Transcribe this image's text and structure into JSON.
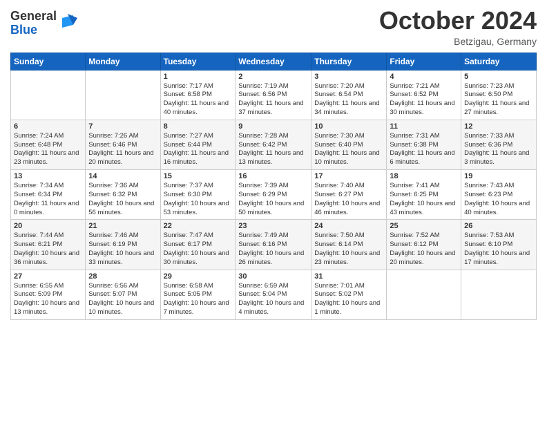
{
  "header": {
    "logo_general": "General",
    "logo_blue": "Blue",
    "month_title": "October 2024",
    "location": "Betzigau, Germany"
  },
  "days_of_week": [
    "Sunday",
    "Monday",
    "Tuesday",
    "Wednesday",
    "Thursday",
    "Friday",
    "Saturday"
  ],
  "weeks": [
    [
      {
        "day": "",
        "sunrise": "",
        "sunset": "",
        "daylight": ""
      },
      {
        "day": "",
        "sunrise": "",
        "sunset": "",
        "daylight": ""
      },
      {
        "day": "1",
        "sunrise": "Sunrise: 7:17 AM",
        "sunset": "Sunset: 6:58 PM",
        "daylight": "Daylight: 11 hours and 40 minutes."
      },
      {
        "day": "2",
        "sunrise": "Sunrise: 7:19 AM",
        "sunset": "Sunset: 6:56 PM",
        "daylight": "Daylight: 11 hours and 37 minutes."
      },
      {
        "day": "3",
        "sunrise": "Sunrise: 7:20 AM",
        "sunset": "Sunset: 6:54 PM",
        "daylight": "Daylight: 11 hours and 34 minutes."
      },
      {
        "day": "4",
        "sunrise": "Sunrise: 7:21 AM",
        "sunset": "Sunset: 6:52 PM",
        "daylight": "Daylight: 11 hours and 30 minutes."
      },
      {
        "day": "5",
        "sunrise": "Sunrise: 7:23 AM",
        "sunset": "Sunset: 6:50 PM",
        "daylight": "Daylight: 11 hours and 27 minutes."
      }
    ],
    [
      {
        "day": "6",
        "sunrise": "Sunrise: 7:24 AM",
        "sunset": "Sunset: 6:48 PM",
        "daylight": "Daylight: 11 hours and 23 minutes."
      },
      {
        "day": "7",
        "sunrise": "Sunrise: 7:26 AM",
        "sunset": "Sunset: 6:46 PM",
        "daylight": "Daylight: 11 hours and 20 minutes."
      },
      {
        "day": "8",
        "sunrise": "Sunrise: 7:27 AM",
        "sunset": "Sunset: 6:44 PM",
        "daylight": "Daylight: 11 hours and 16 minutes."
      },
      {
        "day": "9",
        "sunrise": "Sunrise: 7:28 AM",
        "sunset": "Sunset: 6:42 PM",
        "daylight": "Daylight: 11 hours and 13 minutes."
      },
      {
        "day": "10",
        "sunrise": "Sunrise: 7:30 AM",
        "sunset": "Sunset: 6:40 PM",
        "daylight": "Daylight: 11 hours and 10 minutes."
      },
      {
        "day": "11",
        "sunrise": "Sunrise: 7:31 AM",
        "sunset": "Sunset: 6:38 PM",
        "daylight": "Daylight: 11 hours and 6 minutes."
      },
      {
        "day": "12",
        "sunrise": "Sunrise: 7:33 AM",
        "sunset": "Sunset: 6:36 PM",
        "daylight": "Daylight: 11 hours and 3 minutes."
      }
    ],
    [
      {
        "day": "13",
        "sunrise": "Sunrise: 7:34 AM",
        "sunset": "Sunset: 6:34 PM",
        "daylight": "Daylight: 11 hours and 0 minutes."
      },
      {
        "day": "14",
        "sunrise": "Sunrise: 7:36 AM",
        "sunset": "Sunset: 6:32 PM",
        "daylight": "Daylight: 10 hours and 56 minutes."
      },
      {
        "day": "15",
        "sunrise": "Sunrise: 7:37 AM",
        "sunset": "Sunset: 6:30 PM",
        "daylight": "Daylight: 10 hours and 53 minutes."
      },
      {
        "day": "16",
        "sunrise": "Sunrise: 7:39 AM",
        "sunset": "Sunset: 6:29 PM",
        "daylight": "Daylight: 10 hours and 50 minutes."
      },
      {
        "day": "17",
        "sunrise": "Sunrise: 7:40 AM",
        "sunset": "Sunset: 6:27 PM",
        "daylight": "Daylight: 10 hours and 46 minutes."
      },
      {
        "day": "18",
        "sunrise": "Sunrise: 7:41 AM",
        "sunset": "Sunset: 6:25 PM",
        "daylight": "Daylight: 10 hours and 43 minutes."
      },
      {
        "day": "19",
        "sunrise": "Sunrise: 7:43 AM",
        "sunset": "Sunset: 6:23 PM",
        "daylight": "Daylight: 10 hours and 40 minutes."
      }
    ],
    [
      {
        "day": "20",
        "sunrise": "Sunrise: 7:44 AM",
        "sunset": "Sunset: 6:21 PM",
        "daylight": "Daylight: 10 hours and 36 minutes."
      },
      {
        "day": "21",
        "sunrise": "Sunrise: 7:46 AM",
        "sunset": "Sunset: 6:19 PM",
        "daylight": "Daylight: 10 hours and 33 minutes."
      },
      {
        "day": "22",
        "sunrise": "Sunrise: 7:47 AM",
        "sunset": "Sunset: 6:17 PM",
        "daylight": "Daylight: 10 hours and 30 minutes."
      },
      {
        "day": "23",
        "sunrise": "Sunrise: 7:49 AM",
        "sunset": "Sunset: 6:16 PM",
        "daylight": "Daylight: 10 hours and 26 minutes."
      },
      {
        "day": "24",
        "sunrise": "Sunrise: 7:50 AM",
        "sunset": "Sunset: 6:14 PM",
        "daylight": "Daylight: 10 hours and 23 minutes."
      },
      {
        "day": "25",
        "sunrise": "Sunrise: 7:52 AM",
        "sunset": "Sunset: 6:12 PM",
        "daylight": "Daylight: 10 hours and 20 minutes."
      },
      {
        "day": "26",
        "sunrise": "Sunrise: 7:53 AM",
        "sunset": "Sunset: 6:10 PM",
        "daylight": "Daylight: 10 hours and 17 minutes."
      }
    ],
    [
      {
        "day": "27",
        "sunrise": "Sunrise: 6:55 AM",
        "sunset": "Sunset: 5:09 PM",
        "daylight": "Daylight: 10 hours and 13 minutes."
      },
      {
        "day": "28",
        "sunrise": "Sunrise: 6:56 AM",
        "sunset": "Sunset: 5:07 PM",
        "daylight": "Daylight: 10 hours and 10 minutes."
      },
      {
        "day": "29",
        "sunrise": "Sunrise: 6:58 AM",
        "sunset": "Sunset: 5:05 PM",
        "daylight": "Daylight: 10 hours and 7 minutes."
      },
      {
        "day": "30",
        "sunrise": "Sunrise: 6:59 AM",
        "sunset": "Sunset: 5:04 PM",
        "daylight": "Daylight: 10 hours and 4 minutes."
      },
      {
        "day": "31",
        "sunrise": "Sunrise: 7:01 AM",
        "sunset": "Sunset: 5:02 PM",
        "daylight": "Daylight: 10 hours and 1 minute."
      },
      {
        "day": "",
        "sunrise": "",
        "sunset": "",
        "daylight": ""
      },
      {
        "day": "",
        "sunrise": "",
        "sunset": "",
        "daylight": ""
      }
    ]
  ]
}
